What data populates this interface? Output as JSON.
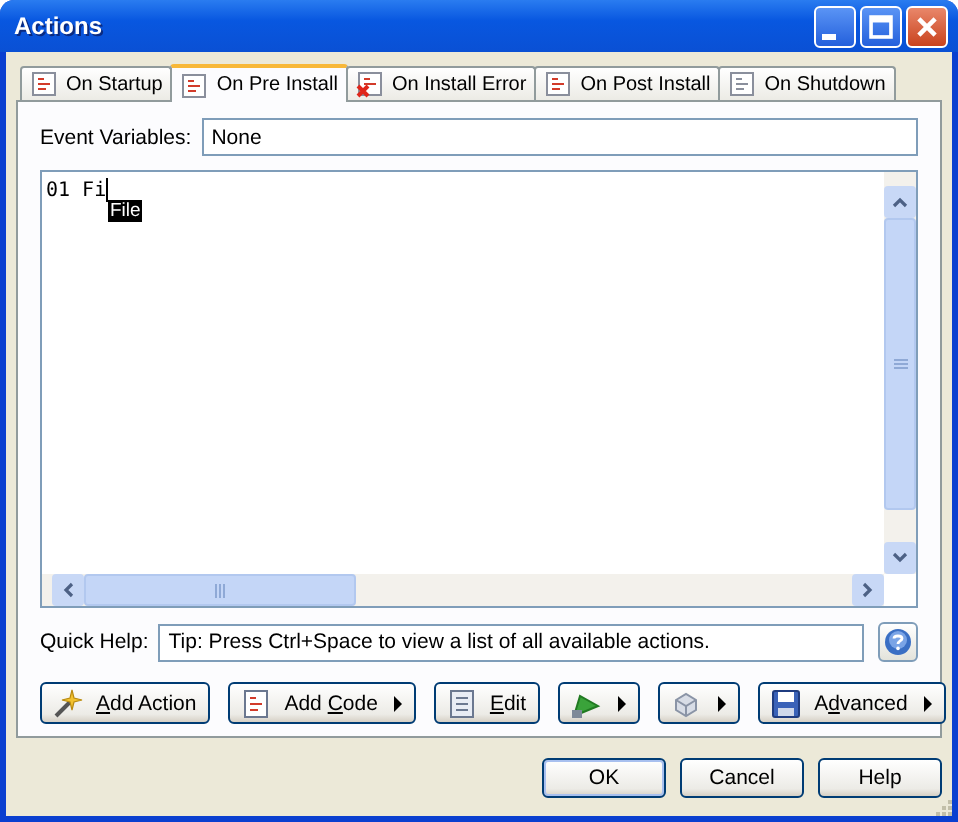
{
  "window": {
    "title": "Actions"
  },
  "tabs": [
    {
      "label": "On Startup",
      "selected": false
    },
    {
      "label": "On Pre Install",
      "selected": true
    },
    {
      "label": "On Install Error",
      "selected": false
    },
    {
      "label": "On Post Install",
      "selected": false
    },
    {
      "label": "On Shutdown",
      "selected": false
    }
  ],
  "event_variables": {
    "label": "Event Variables:",
    "value": "None"
  },
  "editor": {
    "lines": [
      {
        "number": "01",
        "text": "Fi"
      }
    ],
    "autocomplete": [
      {
        "label": "File",
        "selected": true
      }
    ]
  },
  "quick_help": {
    "label": "Quick Help:",
    "value": "Tip: Press Ctrl+Space to view a list of all available actions."
  },
  "action_buttons": [
    {
      "parts": [
        {
          "text": "A",
          "underlined": true
        },
        {
          "text": "dd Action",
          "underlined": false
        }
      ],
      "dropdown": false
    },
    {
      "parts": [
        {
          "text": "Add ",
          "underlined": false
        },
        {
          "text": "C",
          "underlined": true
        },
        {
          "text": "ode",
          "underlined": false
        }
      ],
      "dropdown": true
    },
    {
      "parts": [
        {
          "text": "E",
          "underlined": true
        },
        {
          "text": "dit",
          "underlined": false
        }
      ],
      "dropdown": false
    },
    {
      "dropdown": true
    },
    {
      "dropdown": true
    },
    {
      "parts": [
        {
          "text": "A",
          "underlined": false
        },
        {
          "text": "d",
          "underlined": true
        },
        {
          "text": "vanced",
          "underlined": false
        }
      ],
      "dropdown": true
    }
  ],
  "dialog_buttons": [
    {
      "label": "OK",
      "default": true
    },
    {
      "label": "Cancel",
      "default": false
    },
    {
      "label": "Help",
      "default": false
    }
  ]
}
